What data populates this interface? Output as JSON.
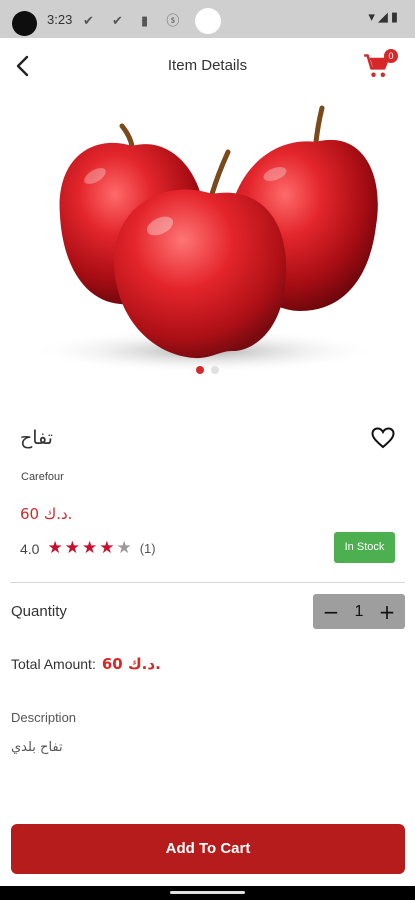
{
  "status_bar": {
    "time": "3:23",
    "left_icons": "✔ ✔ ▮ ⓢ",
    "right_icons": "▾◢▮"
  },
  "header": {
    "title": "Item Details",
    "back_icon": "back-arrow-icon",
    "cart_icon": "cart-icon",
    "cart_count": "0"
  },
  "gallery": {
    "image": "red-apples-image",
    "dot_count": 2,
    "active_index": 0
  },
  "product": {
    "name": "تفاح",
    "brand": "Carefour",
    "price": "60 د.ك.",
    "rating": "4.0",
    "rating_value": 4,
    "rating_max": 5,
    "review_count": "(1)",
    "stock_status": "In Stock",
    "favorite_icon": "heart-outline-icon"
  },
  "quantity": {
    "label": "Quantity",
    "value": "1",
    "decrement_symbol": "−",
    "increment_symbol": "+"
  },
  "total": {
    "label": "Total Amount:",
    "value": "60 د.ك."
  },
  "description": {
    "label": "Description",
    "text": "تفاح بلدي"
  },
  "actions": {
    "add_to_cart": "Add To Cart"
  },
  "colors": {
    "accent": "#d62828",
    "button": "#b71c1c",
    "in_stock": "#4caf50",
    "star_on": "#c8102e",
    "star_off": "#9a9a9a"
  }
}
